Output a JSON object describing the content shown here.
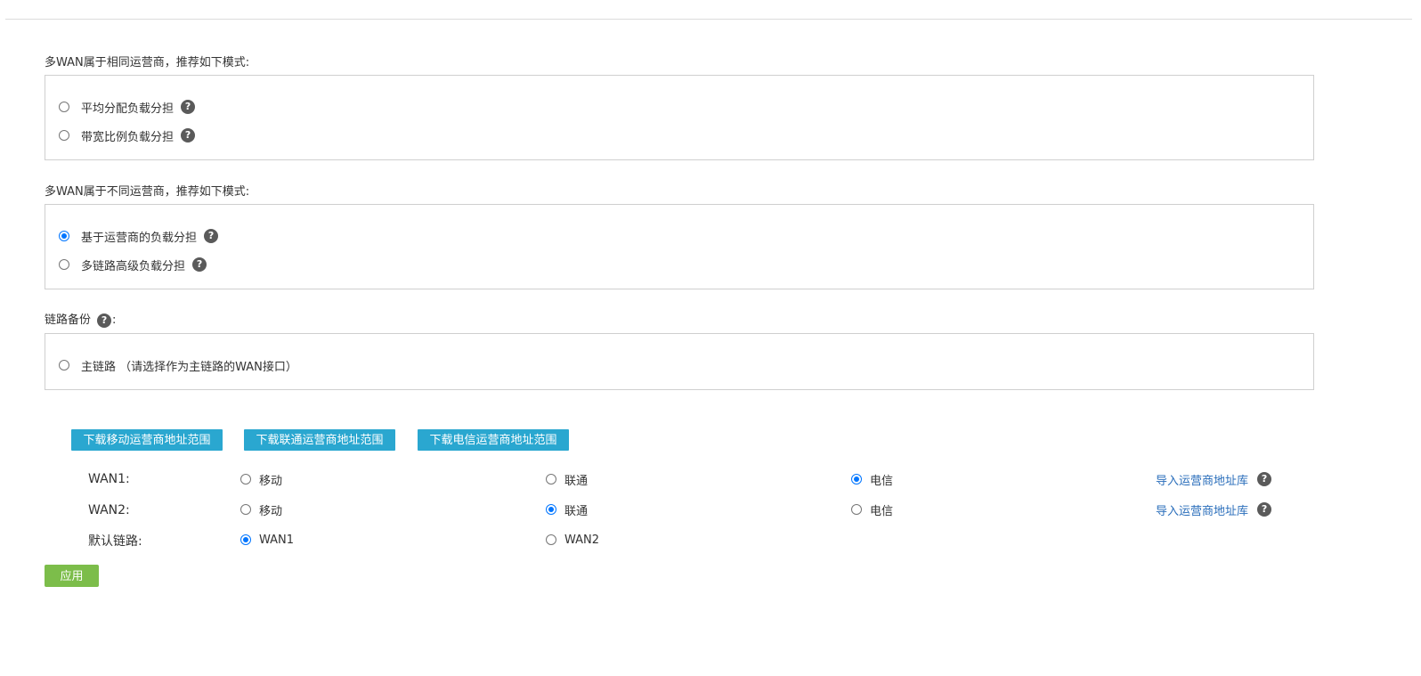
{
  "same_isp": {
    "title": "多WAN属于相同运营商，推荐如下模式:",
    "options": [
      {
        "label": "平均分配负载分担",
        "checked": false
      },
      {
        "label": "带宽比例负载分担",
        "checked": false
      }
    ]
  },
  "diff_isp": {
    "title": "多WAN属于不同运营商，推荐如下模式:",
    "options": [
      {
        "label": "基于运营商的负载分担",
        "checked": true
      },
      {
        "label": "多链路高级负载分担",
        "checked": false
      }
    ]
  },
  "backup": {
    "title": "链路备份",
    "title_suffix": ":",
    "options": [
      {
        "label": "主链路 （请选择作为主链路的WAN接口）",
        "checked": false
      }
    ]
  },
  "download_buttons": [
    "下载移动运营商地址范围",
    "下载联通运营商地址范围",
    "下载电信运营商地址范围"
  ],
  "isp_table": {
    "rows": [
      {
        "label": "WAN1:",
        "options": [
          {
            "label": "移动",
            "checked": false
          },
          {
            "label": "联通",
            "checked": false
          },
          {
            "label": "电信",
            "checked": true
          }
        ],
        "link": "导入运营商地址库"
      },
      {
        "label": "WAN2:",
        "options": [
          {
            "label": "移动",
            "checked": false
          },
          {
            "label": "联通",
            "checked": true
          },
          {
            "label": "电信",
            "checked": false
          }
        ],
        "link": "导入运营商地址库"
      }
    ],
    "default_link": {
      "label": "默认链路:",
      "options": [
        {
          "label": "WAN1",
          "checked": true
        },
        {
          "label": "WAN2",
          "checked": false
        }
      ]
    }
  },
  "help_glyph": "?",
  "icons": {
    "help": "question-circle-icon",
    "radio": "radio-button"
  },
  "apply_label": "应用",
  "colors": {
    "download_button": "#2aa7d0",
    "apply_button": "#7cbd4a",
    "link": "#2a6ebb",
    "radio_checked": "#0075ff",
    "help_icon": "#5a5a5a"
  }
}
